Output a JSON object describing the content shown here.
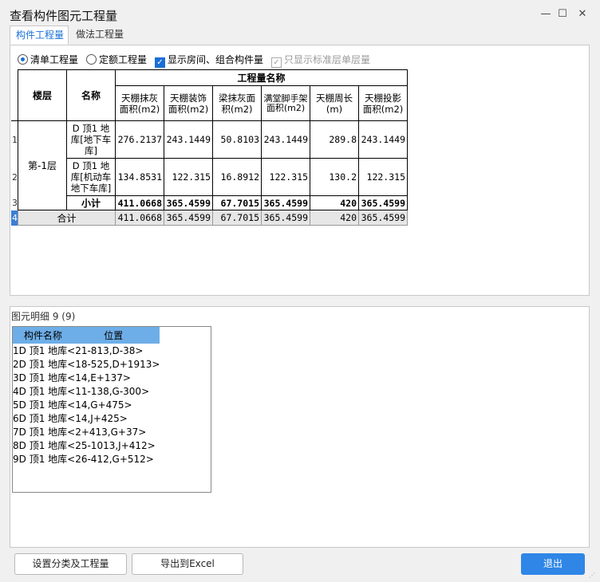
{
  "window": {
    "title": "查看构件图元工程量",
    "min": "—",
    "max": "☐",
    "close": "✕"
  },
  "tabs": [
    "构件工程量",
    "做法工程量"
  ],
  "options": {
    "radio1": "清单工程量",
    "radio2": "定额工程量",
    "check1": "显示房间、组合构件量",
    "check2": "只显示标准层单层量"
  },
  "quantity_table": {
    "col_floor": "楼层",
    "col_name": "名称",
    "group_header": "工程量名称",
    "columns": [
      "天棚抹灰面积(m2)",
      "天棚装饰面积(m2)",
      "梁抹灰面积(m2)",
      "满堂脚手架面积(m2)",
      "天棚周长(m)",
      "天棚投影面积(m2)"
    ],
    "floor": "第-1层",
    "rows": [
      {
        "rn": "1",
        "name": "D 顶1 地库[地下车库]",
        "values": [
          "276.2137",
          "243.1449",
          "50.8103",
          "243.1449",
          "289.8",
          "243.1449"
        ]
      },
      {
        "rn": "2",
        "name": "D 顶1 地库[机动车地下车库]",
        "values": [
          "134.8531",
          "122.315",
          "16.8912",
          "122.315",
          "130.2",
          "122.315"
        ]
      },
      {
        "rn": "3",
        "name": "小计",
        "values": [
          "411.0668",
          "365.4599",
          "67.7015",
          "365.4599",
          "420",
          "365.4599"
        ]
      }
    ],
    "total": {
      "rn": "4",
      "label": "合计",
      "values": [
        "411.0668",
        "365.4599",
        "67.7015",
        "365.4599",
        "420",
        "365.4599"
      ]
    }
  },
  "detail": {
    "title": "图元明细  9 (9)",
    "headers": [
      "构件名称",
      "位置"
    ],
    "rows": [
      {
        "rn": "1",
        "name": "D 顶1 地库",
        "pos": "<21-813,D-38>"
      },
      {
        "rn": "2",
        "name": "D 顶1 地库",
        "pos": "<18-525,D+1913>"
      },
      {
        "rn": "3",
        "name": "D 顶1 地库",
        "pos": "<14,E+137>"
      },
      {
        "rn": "4",
        "name": "D 顶1 地库",
        "pos": "<11-138,G-300>"
      },
      {
        "rn": "5",
        "name": "D 顶1 地库",
        "pos": "<14,G+475>"
      },
      {
        "rn": "6",
        "name": "D 顶1 地库",
        "pos": "<14,J+425>"
      },
      {
        "rn": "7",
        "name": "D 顶1 地库",
        "pos": "<2+413,G+37>"
      },
      {
        "rn": "8",
        "name": "D 顶1 地库",
        "pos": "<25-1013,J+412>"
      },
      {
        "rn": "9",
        "name": "D 顶1 地库",
        "pos": "<26-412,G+512>"
      }
    ]
  },
  "buttons": {
    "settings": "设置分类及工程量",
    "export": "导出到Excel",
    "exit": "退出"
  },
  "colors": {
    "accent": "#2f86e6",
    "header": "#6eaee8",
    "row_bg": "#cde5fb"
  }
}
